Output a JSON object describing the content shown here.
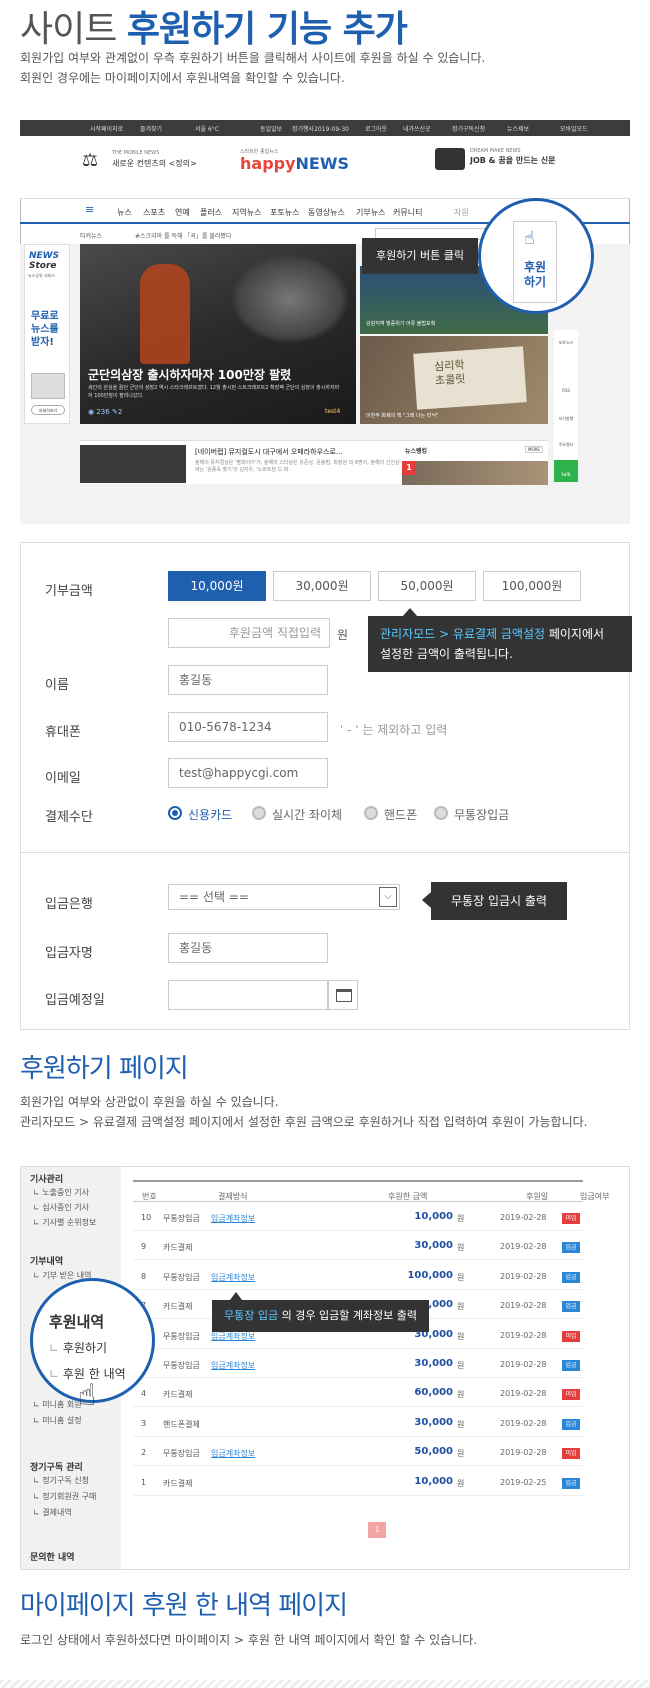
{
  "heading": {
    "pre": "사이트 ",
    "bold": "후원하기 기능 추가"
  },
  "intro": [
    "회원가입 여부와 관계없이 우측 후원하기 버튼을 클릭해서 사이트에 후원을 하실 수 있습니다.",
    "회원인 경우에는 마이페이지에서 후원내역을 확인할 수 있습니다."
  ],
  "site": {
    "topbar": [
      "시작페이지로",
      "즐겨찾기",
      "서울 6°C",
      "동일일보",
      "정기행사2019-09-30",
      "로그아웃",
      "내가쓰신곳",
      "정기구독신청",
      "뉴스제보",
      "모바일모드"
    ],
    "brand_small": "THE MOBILE NEWS",
    "brand_left": "새로운 컨텐츠의 <정의>",
    "logo_sub": "스마트한 종합뉴스",
    "logo_a": "happy",
    "logo_b": "NEWS",
    "brand_right_small": "DREAM MAKE NEWS",
    "brand_right": "JOB & 꿈을 만드는 신문",
    "gnb": [
      "뉴스",
      "스포츠",
      "연예",
      "플러스",
      "지역뉴스",
      "포토뉴스",
      "동영상뉴스",
      "기부뉴스",
      "커뮤니티"
    ],
    "gnb_more": "자원",
    "sub_label": "티커뉴스",
    "sub_text": "#스크리마 를 득해 「곡」를 불러봤다",
    "store_title": [
      "NEWS",
      "Store"
    ],
    "store_sub": "뉴스공유 서비스",
    "store_free": [
      "무료로",
      "뉴스를",
      "받자!"
    ],
    "store_btn": "자세히보기",
    "main_title": "군단의삼장 출시하자마자 100만장 팔렸",
    "main_desc": "세간의 관심을 끌던 군단의 삼장2 역시 스타크래프트였다. 12월 출시된 스트크래프트2 확장팩 군단의 심장이 출시하자마자 100만장이 팔려나갔다.",
    "main_stats": [
      "236",
      "2"
    ],
    "main_author": "test4",
    "thumb1": "강원지역 별증위기 어류 불법포획",
    "thumb2": "이번주 화제의 책 \"그레 나는 터닉\"",
    "book_text": [
      "심리학",
      "초콜릿"
    ],
    "float_label": [
      "후원",
      "하기"
    ],
    "tip_click": "후원하기 버튼 클릭",
    "right_side": [
      "포토뉴스",
      "RSS",
      "지식발행",
      "주요행사",
      "talk"
    ],
    "bottom_title": "[네이버랩] 뮤지컬도시 대구에서 오페라하우스로...",
    "bottom_desc": "올해의 뮤지컬상은 '팜파이어'가, 올해의 스타상은 유준상, 윤봉범, 최정원 외 8명이, 올해의 신인상에는 '김종욱 찾기'의 김지우, '노르트담 드 파",
    "bottom_news": "뉴스랭킹",
    "more": "MORE",
    "rank_no": "1"
  },
  "form": {
    "amount_label": "기부금액",
    "amounts": [
      "10,000원",
      "30,000원",
      "50,000원",
      "100,000원"
    ],
    "direct_placeholder": "후원금액 직접입력",
    "won": "원",
    "tip_amount_hl": "관리자모드 >  유료결제 금액설정",
    "tip_amount_rest": " 페이지에서",
    "tip_amount_line2": "설정한 금액이 출력됩니다.",
    "name_label": "이름",
    "name_value": "홍길동",
    "phone_label": "휴대폰",
    "phone_value": "010-5678-1234",
    "phone_hint": "' - ' 는 제외하고 입력",
    "email_label": "이메일",
    "email_value": "test@happycgi.com",
    "pay_label": "결제수단",
    "pay_options": [
      "신용카드",
      "실시간 좌이체",
      "핸드폰",
      "무통장입금"
    ],
    "bank_label": "입금은행",
    "bank_value": "== 선택 ==",
    "tip_bank": "무통장 입금시 출력",
    "depositor_label": "입금자명",
    "depositor_value": "홍길동",
    "date_label": "입금예정일"
  },
  "section2": {
    "title": "후원하기 페이지",
    "desc": [
      "회원가입 여부와 상관없이 후원을 하실 수 있습니다.",
      "관리자모드 > 유료결제 금액설정 페이지에서 설정한 후원 금액으로 후원하거나 직접 입력하여 후원이 가능합니다."
    ]
  },
  "mypage": {
    "side_groups": [
      "기사관리",
      "기부내역",
      "정기구독 관리",
      "문의한 내역"
    ],
    "side_items1": [
      "노출중인 기사",
      "심사중인 기사",
      "기사별 순위정보"
    ],
    "side_items2": [
      "기부 받은 내역"
    ],
    "side_items3": [
      "미니홈 회원",
      "미니홈 설정"
    ],
    "side_items4": [
      "정기구독 신청",
      "정기회원권 구매",
      "결제내역"
    ],
    "circle_title": "후원내역",
    "circle_items": [
      "후원하기",
      "후원 한 내역"
    ],
    "columns": [
      "번호",
      "결제방식",
      "후원한 금액",
      "후원일",
      "입금여부"
    ],
    "rows": [
      {
        "no": "10",
        "method": "무통장입금",
        "link": "입금계좌정보",
        "amount": "10,000",
        "date": "2019-02-28",
        "status": "미입"
      },
      {
        "no": "9",
        "method": "카드결제",
        "link": "",
        "amount": "30,000",
        "date": "2019-02-28",
        "status": "입금"
      },
      {
        "no": "8",
        "method": "무통장입금",
        "link": "입금계좌정보",
        "amount": "100,000",
        "date": "2019-02-28",
        "status": "입금"
      },
      {
        "no": "7",
        "method": "카드결제",
        "link": "",
        "amount": "10,000",
        "date": "2019-02-28",
        "status": "입금"
      },
      {
        "no": "6",
        "method": "무통장입금",
        "link": "입금계좌정보",
        "amount": "30,000",
        "date": "2019-02-28",
        "status": "미입"
      },
      {
        "no": "5",
        "method": "무통장입금",
        "link": "입금계좌정보",
        "amount": "30,000",
        "date": "2019-02-28",
        "status": "입금"
      },
      {
        "no": "4",
        "method": "카드결제",
        "link": "",
        "amount": "60,000",
        "date": "2019-02-28",
        "status": "미입"
      },
      {
        "no": "3",
        "method": "핸드폰결제",
        "link": "",
        "amount": "30,000",
        "date": "2019-02-28",
        "status": "입금"
      },
      {
        "no": "2",
        "method": "무통장입금",
        "link": "입금계좌정보",
        "amount": "50,000",
        "date": "2019-02-28",
        "status": "미입"
      },
      {
        "no": "1",
        "method": "카드결제",
        "link": "",
        "amount": "10,000",
        "date": "2019-02-25",
        "status": "입금"
      }
    ],
    "won": "원",
    "tip_hl": "무통장 입금",
    "tip_rest": " 의 경우 입금할 계좌정보 출력",
    "page": "1"
  },
  "section3": {
    "title": "마이페이지 후원 한 내역 페이지",
    "desc": "로그인 상태에서 후원하셨다면 마이페이지 > 후원 한 내역 페이지에서 확인 할 수 있습니다."
  },
  "colors": {
    "accent": "#1e5fb0",
    "red": "#e53c3c",
    "blue": "#2a86d6",
    "tip": "#333333"
  }
}
